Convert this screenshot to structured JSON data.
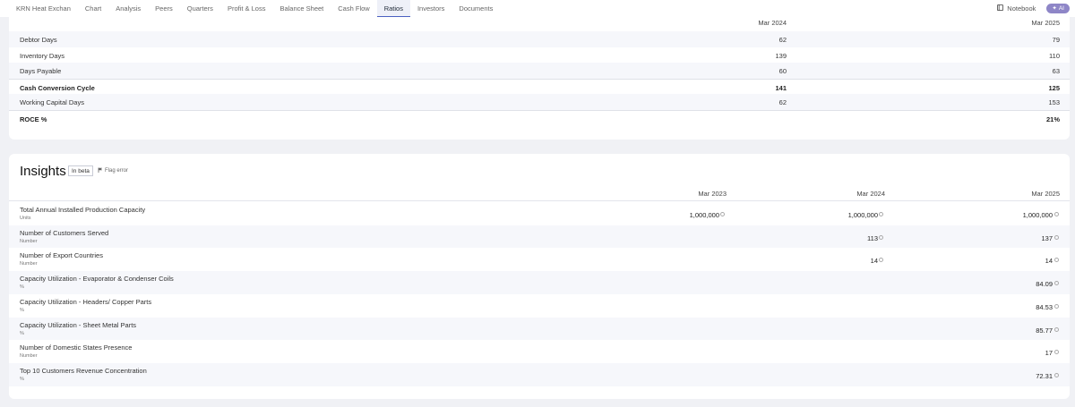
{
  "nav": {
    "tabs": [
      {
        "label": "KRN Heat Exchan"
      },
      {
        "label": "Chart"
      },
      {
        "label": "Analysis"
      },
      {
        "label": "Peers"
      },
      {
        "label": "Quarters"
      },
      {
        "label": "Profit & Loss"
      },
      {
        "label": "Balance Sheet"
      },
      {
        "label": "Cash Flow"
      },
      {
        "label": "Ratios"
      },
      {
        "label": "Investors"
      },
      {
        "label": "Documents"
      }
    ],
    "active_tab": "Ratios",
    "notebook_label": "Notebook",
    "ai_label": "AI"
  },
  "ratios": {
    "columns": [
      "Mar 2024",
      "Mar 2025"
    ],
    "rows": [
      {
        "label": "Debtor Days",
        "values": [
          "62",
          "79"
        ]
      },
      {
        "label": "Inventory Days",
        "values": [
          "139",
          "110"
        ]
      },
      {
        "label": "Days Payable",
        "values": [
          "60",
          "63"
        ]
      },
      {
        "label": "Cash Conversion Cycle",
        "values": [
          "141",
          "125"
        ]
      },
      {
        "label": "Working Capital Days",
        "values": [
          "62",
          "153"
        ]
      },
      {
        "label": "ROCE %",
        "values": [
          "",
          "21%"
        ]
      }
    ]
  },
  "insights": {
    "title": "Insights",
    "beta_label": "In beta",
    "flag_label": "Flag error",
    "columns": [
      "Mar 2023",
      "Mar 2024",
      "Mar 2025"
    ],
    "rows": [
      {
        "name": "Total Annual Installed Production Capacity",
        "unit": "Units",
        "values": [
          "1,000,000",
          "1,000,000",
          "1,000,000"
        ]
      },
      {
        "name": "Number of Customers Served",
        "unit": "Number",
        "values": [
          "",
          "113",
          "137"
        ]
      },
      {
        "name": "Number of Export Countries",
        "unit": "Number",
        "values": [
          "",
          "14",
          "14"
        ]
      },
      {
        "name": "Capacity Utilization - Evaporator & Condenser Coils",
        "unit": "%",
        "values": [
          "",
          "",
          "84.09"
        ]
      },
      {
        "name": "Capacity Utilization - Headers/ Copper Parts",
        "unit": "%",
        "values": [
          "",
          "",
          "84.53"
        ]
      },
      {
        "name": "Capacity Utilization - Sheet Metal Parts",
        "unit": "%",
        "values": [
          "",
          "",
          "85.77"
        ]
      },
      {
        "name": "Number of Domestic States Presence",
        "unit": "Number",
        "values": [
          "",
          "",
          "17"
        ]
      },
      {
        "name": "Top 10 Customers Revenue Concentration",
        "unit": "%",
        "values": [
          "",
          "",
          "72.31"
        ]
      }
    ]
  },
  "colors": {
    "accent": "#4a5fc1",
    "ai_badge": "#8e86c7",
    "row_alt": "#f6f7fb",
    "page_bg": "#f0f1f5"
  }
}
